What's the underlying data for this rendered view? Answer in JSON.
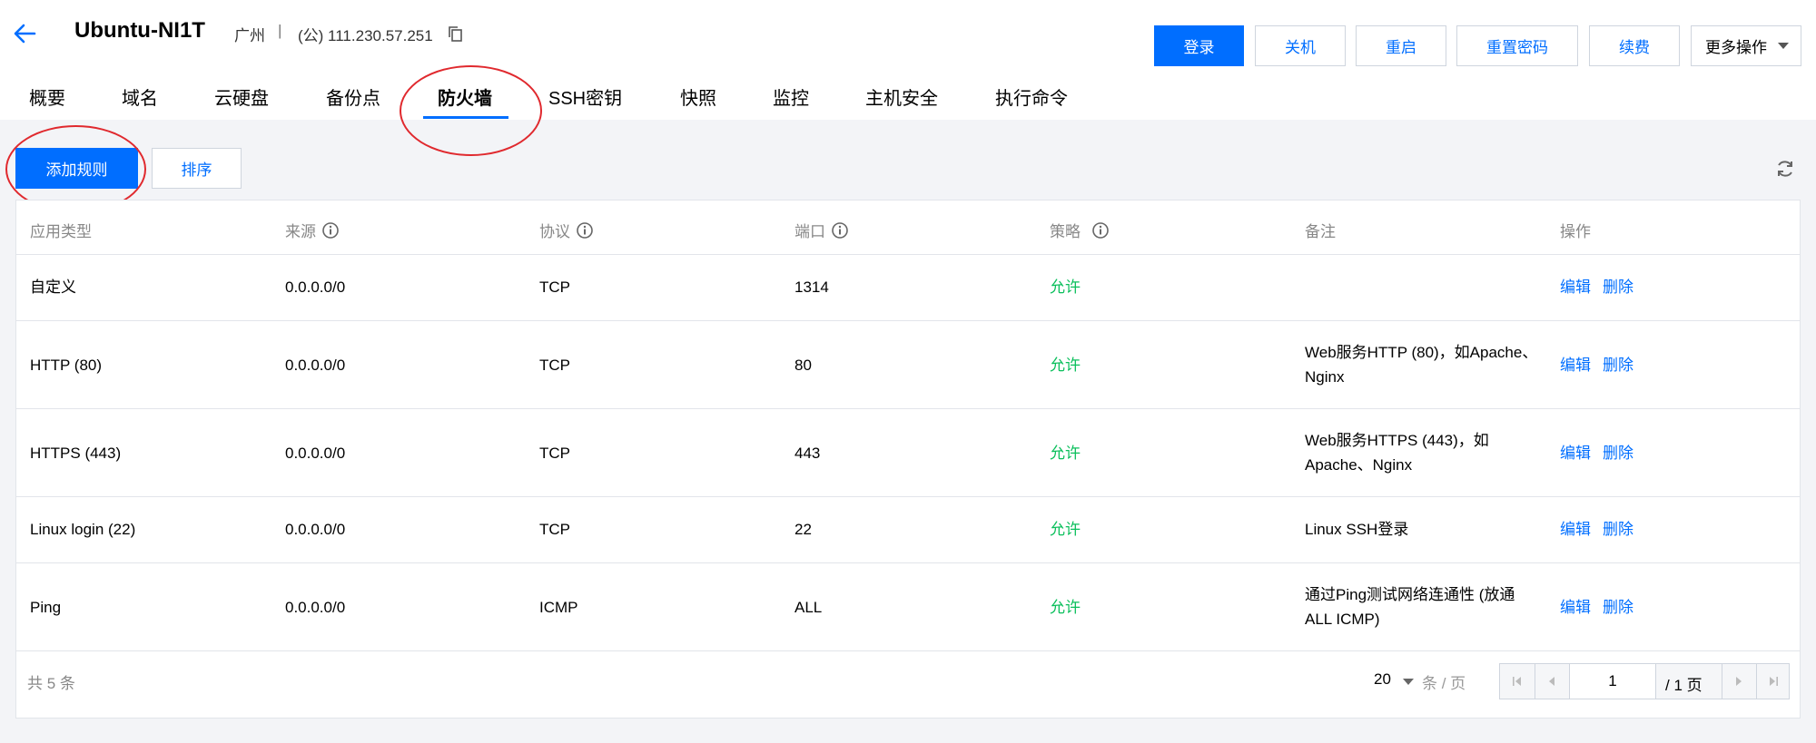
{
  "header": {
    "instance_name": "Ubuntu-NI1T",
    "region": "广州",
    "separator": "|",
    "ip": "(公) 111.230.57.251"
  },
  "actions": {
    "login": "登录",
    "shutdown": "关机",
    "restart": "重启",
    "reset_password": "重置密码",
    "renew": "续费",
    "more": "更多操作"
  },
  "tabs": [
    {
      "label": "概要"
    },
    {
      "label": "域名"
    },
    {
      "label": "云硬盘"
    },
    {
      "label": "备份点"
    },
    {
      "label": "防火墙"
    },
    {
      "label": "SSH密钥"
    },
    {
      "label": "快照"
    },
    {
      "label": "监控"
    },
    {
      "label": "主机安全"
    },
    {
      "label": "执行命令"
    }
  ],
  "active_tab": "防火墙",
  "toolbar": {
    "add_rule": "添加规则",
    "sort": "排序"
  },
  "table": {
    "columns": [
      "应用类型",
      "来源",
      "协议",
      "端口",
      "策略",
      "备注",
      "操作"
    ],
    "rows": [
      {
        "type": "自定义",
        "source": "0.0.0.0/0",
        "protocol": "TCP",
        "port": "1314",
        "policy": "允许",
        "note": "",
        "edit": "编辑",
        "delete": "删除"
      },
      {
        "type": "HTTP (80)",
        "source": "0.0.0.0/0",
        "protocol": "TCP",
        "port": "80",
        "policy": "允许",
        "note": "Web服务HTTP (80)，如Apache、Nginx",
        "edit": "编辑",
        "delete": "删除"
      },
      {
        "type": "HTTPS (443)",
        "source": "0.0.0.0/0",
        "protocol": "TCP",
        "port": "443",
        "policy": "允许",
        "note": "Web服务HTTPS (443)，如Apache、Nginx",
        "edit": "编辑",
        "delete": "删除"
      },
      {
        "type": "Linux login (22)",
        "source": "0.0.0.0/0",
        "protocol": "TCP",
        "port": "22",
        "policy": "允许",
        "note": "Linux SSH登录",
        "edit": "编辑",
        "delete": "删除"
      },
      {
        "type": "Ping",
        "source": "0.0.0.0/0",
        "protocol": "ICMP",
        "port": "ALL",
        "policy": "允许",
        "note": "通过Ping测试网络连通性 (放通ALL ICMP)",
        "edit": "编辑",
        "delete": "删除"
      }
    ]
  },
  "footer": {
    "total": "共 5 条",
    "page_size": "20",
    "per_page": "条 / 页",
    "current_page": "1",
    "total_pages": "/ 1 页"
  },
  "colors": {
    "accent": "#006eff",
    "allow": "#0abf5b",
    "annotation": "#e0292e"
  }
}
